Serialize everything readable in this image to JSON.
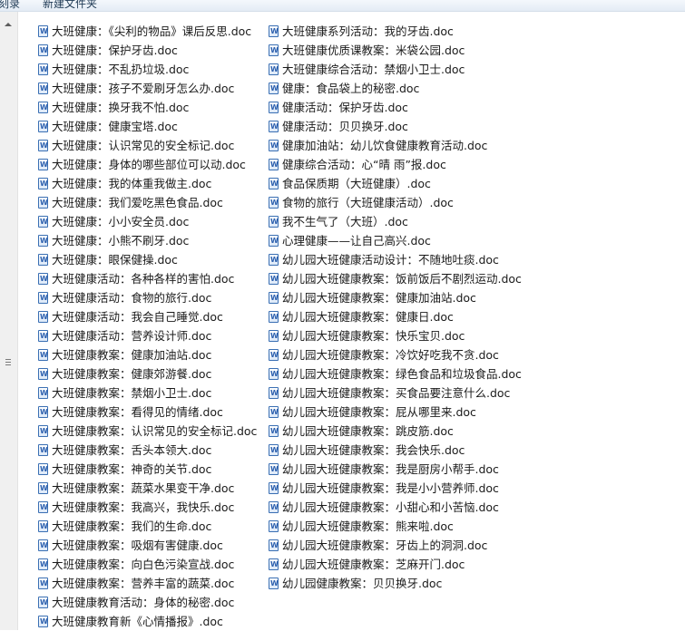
{
  "toolbar": {
    "left_label": "刻录",
    "new_folder_label": "新建文件夹"
  },
  "icons": {
    "file_icon": "word-doc-icon"
  },
  "files_col1": [
    "大班健康：《尖利的物品》课后反思.doc",
    "大班健康：保护牙齿.doc",
    "大班健康：不乱扔垃圾.doc",
    "大班健康：孩子不爱刷牙怎么办.doc",
    "大班健康：换牙我不怕.doc",
    "大班健康：健康宝塔.doc",
    "大班健康：认识常见的安全标记.doc",
    "大班健康：身体的哪些部位可以动.doc",
    "大班健康：我的体重我做主.doc",
    "大班健康：我们爱吃黑色食品.doc",
    "大班健康：小小安全员.doc",
    "大班健康：小熊不刷牙.doc",
    "大班健康：眼保健操.doc",
    "大班健康活动：各种各样的害怕.doc",
    "大班健康活动：食物的旅行.doc",
    "大班健康活动：我会自己睡觉.doc",
    "大班健康活动：营养设计师.doc",
    "大班健康教案：健康加油站.doc",
    "大班健康教案：健康郊游餐.doc",
    "大班健康教案：禁烟小卫士.doc",
    "大班健康教案：看得见的情绪.doc",
    "大班健康教案：认识常见的安全标记.doc",
    "大班健康教案：舌头本领大.doc",
    "大班健康教案：神奇的关节.doc",
    "大班健康教案：蔬菜水果变干净.doc",
    "大班健康教案：我高兴，我快乐.doc",
    "大班健康教案：我们的生命.doc",
    "大班健康教案：吸烟有害健康.doc",
    "大班健康教案：向白色污染宣战.doc",
    "大班健康教案：营养丰富的蔬菜.doc",
    "大班健康教育活动：身体的秘密.doc",
    "大班健康教育新《心情播报》.doc"
  ],
  "files_col2": [
    "大班健康系列活动：我的牙齿.doc",
    "大班健康优质课教案：米袋公园.doc",
    "大班健康综合活动：禁烟小卫士.doc",
    "健康：食品袋上的秘密.doc",
    "健康活动：保护牙齿.doc",
    "健康活动：贝贝换牙.doc",
    "健康加油站：幼儿饮食健康教育活动.doc",
    "健康综合活动：心“晴 雨”报.doc",
    "食品保质期（大班健康）.doc",
    "食物的旅行（大班健康活动）.doc",
    "我不生气了（大班）.doc",
    "心理健康——让自己高兴.doc",
    "幼儿园大班健康活动设计：不随地吐痰.doc",
    "幼儿园大班健康教案：饭前饭后不剧烈运动.doc",
    "幼儿园大班健康教案：健康加油站.doc",
    "幼儿园大班健康教案：健康日.doc",
    "幼儿园大班健康教案：快乐宝贝.doc",
    "幼儿园大班健康教案：冷饮好吃我不贪.doc",
    "幼儿园大班健康教案：绿色食品和垃圾食品.doc",
    "幼儿园大班健康教案：买食品要注意什么.doc",
    "幼儿园大班健康教案：屁从哪里来.doc",
    "幼儿园大班健康教案：跳皮筋.doc",
    "幼儿园大班健康教案：我会快乐.doc",
    "幼儿园大班健康教案：我是厨房小帮手.doc",
    "幼儿园大班健康教案：我是小小营养师.doc",
    "幼儿园大班健康教案：小甜心和小苦恼.doc",
    "幼儿园大班健康教案：熊来啦.doc",
    "幼儿园大班健康教案：牙齿上的洞洞.doc",
    "幼儿园大班健康教案：芝麻开门.doc",
    "幼儿园健康教案：贝贝换牙.doc"
  ]
}
